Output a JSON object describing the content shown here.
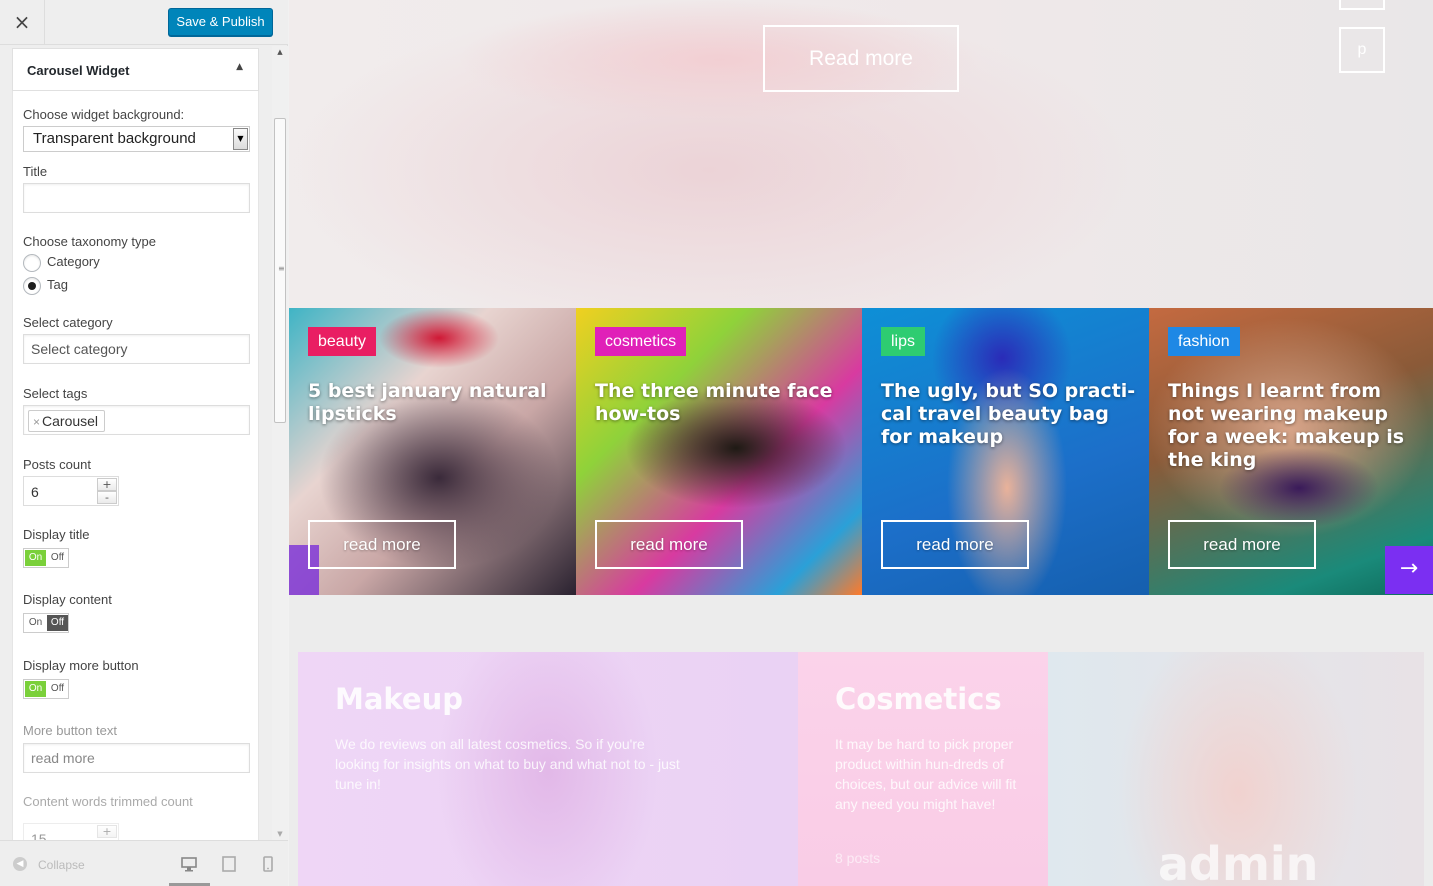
{
  "header": {
    "close_label": "×",
    "save_label": "Save & Publish"
  },
  "widget": {
    "title": "Carousel Widget",
    "collapse_arrow": "▲",
    "background_label": "Choose widget background:",
    "background_value": "Transparent background",
    "title_label": "Title",
    "title_value": "",
    "taxonomy_label": "Choose taxonomy type",
    "taxonomy_options": [
      {
        "label": "Category",
        "checked": false
      },
      {
        "label": "Tag",
        "checked": true
      }
    ],
    "category_label": "Select category",
    "category_placeholder": "Select category",
    "tags_label": "Select tags",
    "tags": [
      "Carousel"
    ],
    "tag_remove": "×",
    "posts_count_label": "Posts count",
    "posts_count": "6",
    "step_up": "+",
    "step_down": "-",
    "display_title_label": "Display title",
    "display_content_label": "Display content",
    "display_more_label": "Display more button",
    "toggle_on": "On",
    "toggle_off": "Off",
    "toggle_states": {
      "display_title": "on",
      "display_content": "off",
      "display_more": "on"
    },
    "more_text_label": "More button text",
    "more_text_value": "read more",
    "trim_label": "Content words trimmed count",
    "trim_value": "15"
  },
  "footer": {
    "collapse_label": "Collapse",
    "devices": [
      "desktop-icon",
      "tablet-icon",
      "mobile-icon"
    ]
  },
  "preview": {
    "hero_button": "Read more",
    "hero_side_letter": "p",
    "carousel": [
      {
        "tag": "beauty",
        "tag_color": "#e91e63",
        "title": "5 best january natural lipsticks",
        "button": "read more"
      },
      {
        "tag": "cosmetics",
        "tag_color": "#e020b8",
        "title": "The three minute face how-tos",
        "button": "read more"
      },
      {
        "tag": "lips",
        "tag_color": "#2ecc71",
        "title": "The ugly, but SO practi-cal travel beauty bag for makeup",
        "button": "read more"
      },
      {
        "tag": "fashion",
        "tag_color": "#1e88e5",
        "title": "Things I learnt from not wearing makeup for a week: makeup is the king",
        "button": "read more"
      }
    ],
    "next_arrow": "→",
    "tiles": [
      {
        "title": "Makeup",
        "text": "We do reviews on all latest cosmetics. So if you're looking for insights on what to buy and what not to - just tune in!"
      },
      {
        "title": "Cosmetics",
        "text": "It may be hard to pick proper product within hun-dreds of choices, but our advice will fit any need you might have!",
        "posts": "8 posts"
      }
    ],
    "admin_label": "admin"
  },
  "colors": {
    "primary_button": "#0085ba",
    "toggle_on": "#7ad03a",
    "arrow_accent": "#7b2ff2"
  }
}
